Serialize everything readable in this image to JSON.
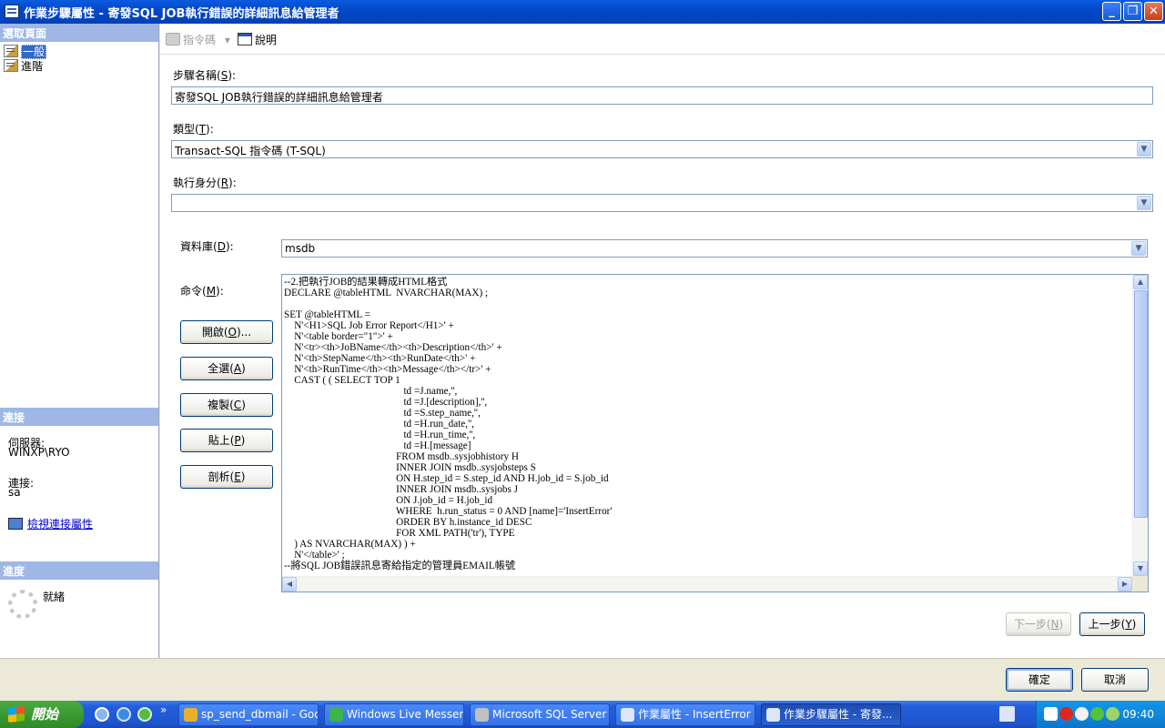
{
  "window": {
    "title": "作業步驟屬性 - 寄發SQL JOB執行錯誤的詳細訊息給管理者",
    "controls": {
      "minimize": "_",
      "maximize": "❐",
      "close": "✕"
    }
  },
  "left_panel": {
    "select_page_header": "選取頁面",
    "pages": [
      {
        "label": "一般",
        "selected": true
      },
      {
        "label": "進階",
        "selected": false
      }
    ],
    "connection_header": "連接",
    "server_label": "伺服器:",
    "server_value": "WINXP\\RYO",
    "connection_label": "連接:",
    "connection_value": "sa",
    "view_connection_link": "檢視連接屬性",
    "progress_header": "進度",
    "progress_status": "就緒"
  },
  "toolbar": {
    "script_label": "指令碼",
    "help_label": "說明"
  },
  "form": {
    "step_name": {
      "label": "步驟名稱(",
      "hotkey": "S",
      "label_end": "):",
      "value": "寄發SQL JOB執行錯誤的詳細訊息給管理者"
    },
    "type": {
      "label": "類型(",
      "hotkey": "T",
      "label_end": "):",
      "value": "Transact-SQL 指令碼 (T-SQL)"
    },
    "run_as": {
      "label": "執行身分(",
      "hotkey": "R",
      "label_end": "):",
      "value": ""
    },
    "database": {
      "label": "資料庫(",
      "hotkey": "D",
      "label_end": "):",
      "value": "msdb"
    },
    "command": {
      "label": "命令(",
      "hotkey": "M",
      "label_end": "):"
    }
  },
  "command_buttons": [
    {
      "name": "open-button",
      "label": "開啟(",
      "hotkey": "O",
      "label_end": ")..."
    },
    {
      "name": "select-all-button",
      "label": "全選(",
      "hotkey": "A",
      "label_end": ")"
    },
    {
      "name": "copy-button",
      "label": "複製(",
      "hotkey": "C",
      "label_end": ")"
    },
    {
      "name": "paste-button",
      "label": "貼上(",
      "hotkey": "P",
      "label_end": ")"
    },
    {
      "name": "parse-button",
      "label": "剖析(",
      "hotkey": "E",
      "label_end": ")"
    }
  ],
  "code_lines": [
    "--2.把執行JOB的結果轉成HTML格式",
    "DECLARE @tableHTML  NVARCHAR(MAX) ;",
    "",
    "SET @tableHTML =",
    "    N'<H1>SQL Job Error Report</H1>' +",
    "    N'<table border=\"1\">' +",
    "    N'<tr><th>JoBName</th><th>Description</th>' +",
    "    N'<th>StepName</th><th>RunDate</th>' +",
    "    N'<th>RunTime</th><th>Message</th></tr>' +",
    "    CAST ( ( SELECT TOP 1",
    "                                               td =J.name,'',",
    "                                               td =J.[description],'',",
    "                                               td =S.step_name,'',",
    "                                               td =H.run_date,'',",
    "                                               td =H.run_time,'',",
    "                                               td =H.[message]",
    "                                            FROM msdb..sysjobhistory H",
    "                                            INNER JOIN msdb..sysjobsteps S",
    "                                            ON H.step_id = S.step_id AND H.job_id = S.job_id",
    "                                            INNER JOIN msdb..sysjobs J",
    "                                            ON J.job_id = H.job_id",
    "                                            WHERE  h.run_status = 0 AND [name]='InsertError'",
    "                                            ORDER BY h.instance_id DESC",
    "                                            FOR XML PATH('tr'), TYPE",
    "    ) AS NVARCHAR(MAX) ) +",
    "    N'</table>' ;",
    "--將SQL JOB錯誤訊息寄給指定的管理員EMAIL帳號"
  ],
  "nav_buttons": {
    "next": {
      "label": "下一步(",
      "hotkey": "N",
      "label_end": ")"
    },
    "prev": {
      "label": "上一步(",
      "hotkey": "Y",
      "label_end": ")"
    }
  },
  "dialog_buttons": {
    "ok": "確定",
    "cancel": "取消"
  },
  "taskbar": {
    "start_label": "開始",
    "chevron": "»",
    "tasks": [
      {
        "label": "sp_send_dbmail - Goo...",
        "icon_color": "#e8b02a"
      },
      {
        "label": "Windows Live Messen...",
        "icon_color": "#3bb54a"
      },
      {
        "label": "Microsoft SQL Server ...",
        "icon_color": "#c0c0c0"
      },
      {
        "label": "作業屬性 - InsertError",
        "icon_color": "#dfe6f3"
      },
      {
        "label": "作業步驟屬性 - 寄發...",
        "icon_color": "#dfe6f3",
        "active": true
      }
    ],
    "clock": "09:40"
  },
  "colors": {
    "title_bar": "#0348c9",
    "section_header": "#9eb7e6",
    "selected_item": "#316ac5",
    "taskbar": "#245edb",
    "start_button": "#3b9a32"
  }
}
